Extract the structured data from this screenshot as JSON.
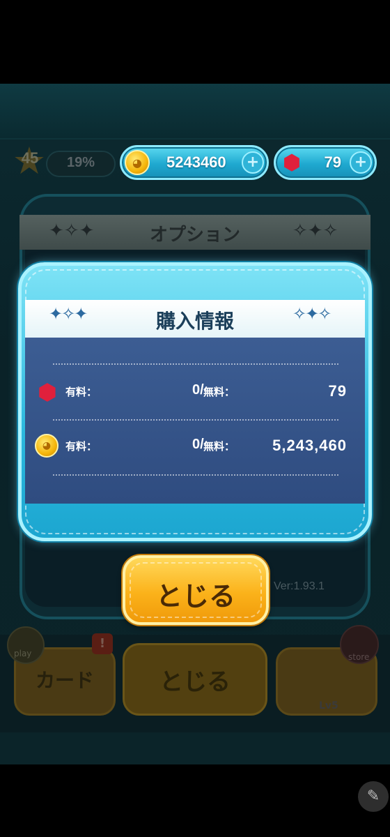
{
  "status": {
    "level": "45",
    "exp_percent": "19%",
    "coins": "5243460",
    "gems": "79"
  },
  "options_panel": {
    "title": "オプション",
    "version": "Ver:1.93.1"
  },
  "purchase_modal": {
    "title": "購入情報",
    "rows": [
      {
        "icon": "gem-icon",
        "paid_label": "有料：",
        "paid_value": "0/",
        "free_label": "無料：",
        "free_value": "79"
      },
      {
        "icon": "coin-icon",
        "paid_label": "有料：",
        "paid_value": "0/",
        "free_label": "無料：",
        "free_value": "5,243,460"
      }
    ],
    "close_label": "とじる"
  },
  "bottom_nav": {
    "play_label": "play",
    "card_label": "カード",
    "card_badge": "!",
    "close_label": "とじる",
    "store_label": "store",
    "tsum_level": "Lv5"
  },
  "colors": {
    "accent": "#2cb9df",
    "button": "#fbb21a",
    "gem": "#e0203c",
    "coin": "#f5b50a"
  }
}
